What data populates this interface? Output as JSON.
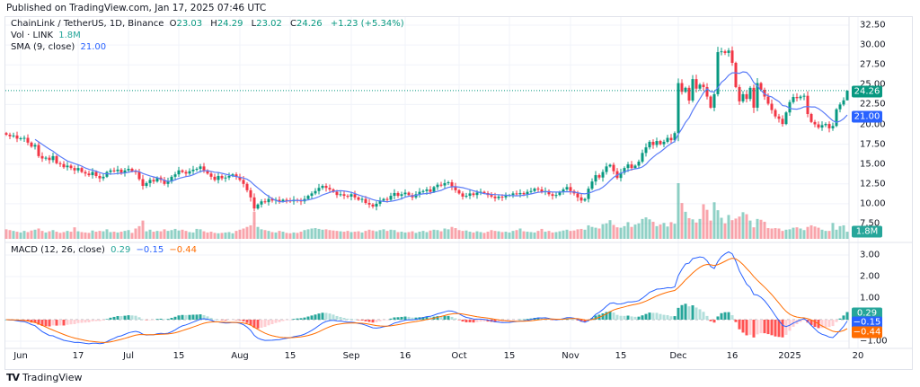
{
  "header": {
    "published": "Published on TradingView.com, Jan 17, 2025 07:46 UTC"
  },
  "legend": {
    "symbol": "ChainLink / TetherUS, 1D, Binance",
    "open_label": "O",
    "open": "23.03",
    "high_label": "H",
    "high": "24.29",
    "low_label": "L",
    "low": "23.02",
    "close_label": "C",
    "close": "24.26",
    "change": "+1.23 (+5.34%)",
    "vol_label": "Vol · LINK",
    "vol_value": "1.8M",
    "sma_label": "SMA (9, close)",
    "sma_value": "21.00",
    "macd_label": "MACD (12, 26, close)",
    "macd_hist": "0.29",
    "macd_line": "−0.15",
    "macd_signal": "−0.44"
  },
  "price_axis": [
    "32.50",
    "30.00",
    "27.50",
    "25.00",
    "22.50",
    "20.00",
    "17.50",
    "15.00",
    "12.50",
    "10.00",
    "7.50"
  ],
  "macd_axis": [
    "3.00",
    "2.00",
    "1.00",
    "−1.00"
  ],
  "badges": {
    "price": "24.26",
    "sma": "21.00",
    "volume": "1.8M",
    "hist": "0.29",
    "macd": "−0.15",
    "signal": "−0.44"
  },
  "x_ticks": [
    {
      "label": "Jun",
      "date": "2024-06-01"
    },
    {
      "label": "17",
      "date": "2024-06-17"
    },
    {
      "label": "Jul",
      "date": "2024-07-01"
    },
    {
      "label": "15",
      "date": "2024-07-15"
    },
    {
      "label": "Aug",
      "date": "2024-08-01"
    },
    {
      "label": "15",
      "date": "2024-08-15"
    },
    {
      "label": "Sep",
      "date": "2024-09-01"
    },
    {
      "label": "16",
      "date": "2024-09-16"
    },
    {
      "label": "Oct",
      "date": "2024-10-01"
    },
    {
      "label": "15",
      "date": "2024-10-15"
    },
    {
      "label": "Nov",
      "date": "2024-11-01"
    },
    {
      "label": "15",
      "date": "2024-11-15"
    },
    {
      "label": "Dec",
      "date": "2024-12-01"
    },
    {
      "label": "16",
      "date": "2024-12-16"
    },
    {
      "label": "2025",
      "date": "2025-01-01"
    },
    {
      "label": "20",
      "date": "2025-01-20"
    }
  ],
  "footer": {
    "brand": "TradingView"
  },
  "colors": {
    "up": "#089981",
    "down": "#f23645",
    "sma": "#5b7cf7",
    "macd": "#2962ff",
    "signal": "#ff6d00",
    "hist_up": "#26a69a",
    "hist_up_fade": "#b2dfdb",
    "hist_down": "#ff5252",
    "hist_down_fade": "#ffcdd2",
    "grid": "#f0f3fa"
  },
  "chart_data": {
    "type": "candlestick",
    "title": "ChainLink / TetherUS, 1D, Binance",
    "ylim": [
      7.5,
      32.5
    ],
    "macd_ylim": [
      -1,
      3
    ],
    "indicators": [
      "Vol",
      "SMA (9, close)",
      "MACD (12, 26, close)"
    ],
    "last_candle": {
      "open": 23.03,
      "high": 24.29,
      "low": 23.02,
      "close": 24.26
    },
    "close": [
      18.7,
      18.5,
      18.6,
      18.2,
      18.25,
      18.3,
      17.7,
      17.2,
      17.4,
      16.0,
      15.7,
      15.8,
      15.5,
      16.0,
      15.1,
      15.0,
      14.6,
      14.8,
      14.5,
      14.2,
      14.5,
      14.0,
      13.8,
      13.6,
      14.0,
      13.5,
      13.2,
      13.4,
      14.0,
      14.2,
      14.1,
      14.3,
      13.9,
      14.2,
      14.4,
      14.1,
      14.0,
      13.1,
      12.25,
      12.6,
      13.0,
      12.8,
      13.3,
      13.0,
      12.5,
      12.8,
      13.4,
      13.7,
      14.2,
      14.0,
      13.8,
      14.1,
      14.3,
      14.4,
      14.7,
      14.2,
      13.8,
      13.4,
      13.0,
      13.5,
      13.2,
      13.3,
      13.5,
      13.7,
      13.4,
      13.0,
      12.5,
      11.7,
      10.8,
      9.4,
      9.9,
      10.3,
      10.2,
      10.6,
      10.4,
      10.5,
      10.3,
      10.5,
      10.4,
      10.3,
      10.5,
      10.4,
      10.3,
      10.6,
      11.0,
      11.3,
      11.6,
      12.0,
      12.25,
      12.0,
      11.8,
      11.5,
      11.1,
      11.2,
      11.0,
      10.9,
      11.2,
      10.8,
      10.5,
      10.6,
      10.1,
      9.9,
      9.65,
      10.0,
      10.4,
      10.6,
      10.5,
      11.0,
      11.35,
      11.0,
      11.2,
      11.4,
      11.1,
      10.8,
      11.2,
      11.5,
      11.6,
      11.8,
      11.5,
      12.1,
      12.4,
      12.3,
      12.6,
      12.7,
      12.2,
      11.7,
      11.3,
      10.9,
      11.0,
      11.3,
      11.1,
      11.4,
      11.5,
      11.35,
      11.1,
      10.9,
      10.7,
      10.9,
      10.8,
      11.0,
      11.1,
      11.3,
      11.2,
      11.35,
      11.2,
      11.5,
      11.6,
      11.9,
      11.8,
      11.5,
      11.6,
      11.2,
      11.0,
      11.1,
      11.5,
      11.8,
      12.1,
      11.6,
      11.3,
      10.8,
      10.4,
      10.6,
      11.9,
      12.8,
      13.6,
      13.3,
      14.0,
      14.7,
      14.9,
      14.1,
      13.25,
      13.9,
      14.5,
      14.95,
      14.5,
      14.8,
      15.3,
      16.4,
      17.1,
      17.8,
      17.4,
      17.9,
      17.5,
      17.8,
      18.3,
      18.0,
      18.9,
      25.2,
      24.1,
      24.6,
      23.0,
      25.7,
      24.5,
      25.0,
      24.7,
      23.5,
      22.1,
      23.8,
      29.1,
      29.2,
      29.0,
      29.3,
      27.75,
      24.7,
      22.9,
      23.8,
      23.2,
      24.6,
      22.1,
      25.2,
      24.35,
      23.5,
      22.6,
      21.8,
      21.0,
      20.7,
      20.05,
      21.5,
      22.8,
      23.45,
      23.3,
      23.5,
      23.6,
      21.3,
      20.3,
      20.0,
      19.6,
      19.9,
      20.05,
      19.5,
      19.8,
      21.9,
      22.5,
      23.03,
      24.26
    ],
    "volume_millions": [
      2.4,
      2.2,
      2.0,
      1.8,
      1.6,
      2.0,
      1.7,
      2.1,
      2.3,
      2.6,
      2.0,
      1.6,
      1.9,
      2.2,
      1.8,
      1.5,
      1.7,
      2.0,
      1.8,
      2.9,
      1.9,
      1.7,
      1.6,
      1.5,
      2.1,
      1.8,
      2.0,
      1.9,
      2.4,
      1.7,
      1.8,
      1.6,
      1.8,
      2.0,
      2.2,
      1.5,
      2.6,
      3.2,
      4.6,
      1.9,
      2.3,
      1.8,
      2.0,
      1.9,
      2.4,
      2.0,
      2.2,
      2.5,
      2.1,
      2.3,
      2.0,
      1.7,
      1.6,
      2.5,
      2.4,
      1.9,
      1.6,
      1.8,
      1.5,
      1.4,
      1.5,
      1.6,
      1.7,
      1.4,
      2.0,
      2.3,
      2.6,
      3.0,
      3.4,
      6.8,
      3.0,
      2.4,
      2.2,
      2.0,
      1.7,
      1.6,
      2.0,
      1.8,
      1.5,
      1.4,
      1.6,
      1.5,
      1.8,
      2.2,
      2.4,
      2.6,
      2.7,
      2.5,
      2.3,
      2.4,
      2.2,
      2.1,
      2.0,
      1.9,
      1.8,
      2.0,
      1.7,
      1.8,
      1.9,
      1.6,
      2.0,
      2.3,
      2.1,
      1.9,
      2.2,
      2.4,
      2.0,
      2.3,
      2.2,
      1.7,
      1.8,
      1.6,
      1.7,
      1.9,
      1.5,
      1.8,
      2.0,
      1.7,
      2.1,
      2.3,
      2.2,
      1.9,
      2.6,
      2.4,
      3.0,
      2.7,
      2.2,
      2.0,
      2.1,
      1.8,
      1.6,
      1.9,
      1.7,
      1.5,
      1.8,
      2.2,
      2.0,
      1.9,
      1.7,
      1.8,
      1.6,
      2.0,
      2.2,
      2.6,
      1.9,
      1.8,
      1.7,
      1.6,
      2.0,
      2.5,
      1.8,
      2.0,
      1.6,
      1.7,
      1.9,
      2.1,
      2.3,
      2.0,
      2.1,
      2.4,
      2.5,
      2.3,
      3.4,
      3.0,
      2.8,
      2.6,
      3.7,
      3.9,
      4.7,
      3.5,
      2.9,
      2.8,
      3.2,
      4.2,
      3.0,
      3.6,
      3.9,
      5.0,
      5.4,
      4.9,
      4.3,
      3.2,
      3.6,
      4.0,
      3.1,
      4.2,
      3.8,
      14.0,
      9.0,
      6.8,
      5.2,
      4.9,
      4.1,
      5.0,
      8.7,
      7.3,
      4.6,
      9.2,
      7.2,
      5.3,
      3.9,
      6.0,
      4.7,
      5.1,
      5.6,
      6.7,
      6.2,
      4.6,
      2.9,
      5.0,
      4.8,
      4.3,
      2.7,
      2.6,
      2.7,
      2.6,
      2.0,
      2.3,
      2.4,
      2.8,
      2.9,
      2.6,
      2.2,
      3.0,
      3.4,
      3.1,
      2.8,
      2.3,
      2.0,
      2.0,
      4.0,
      2.3,
      3.2,
      3.4,
      1.8
    ]
  }
}
